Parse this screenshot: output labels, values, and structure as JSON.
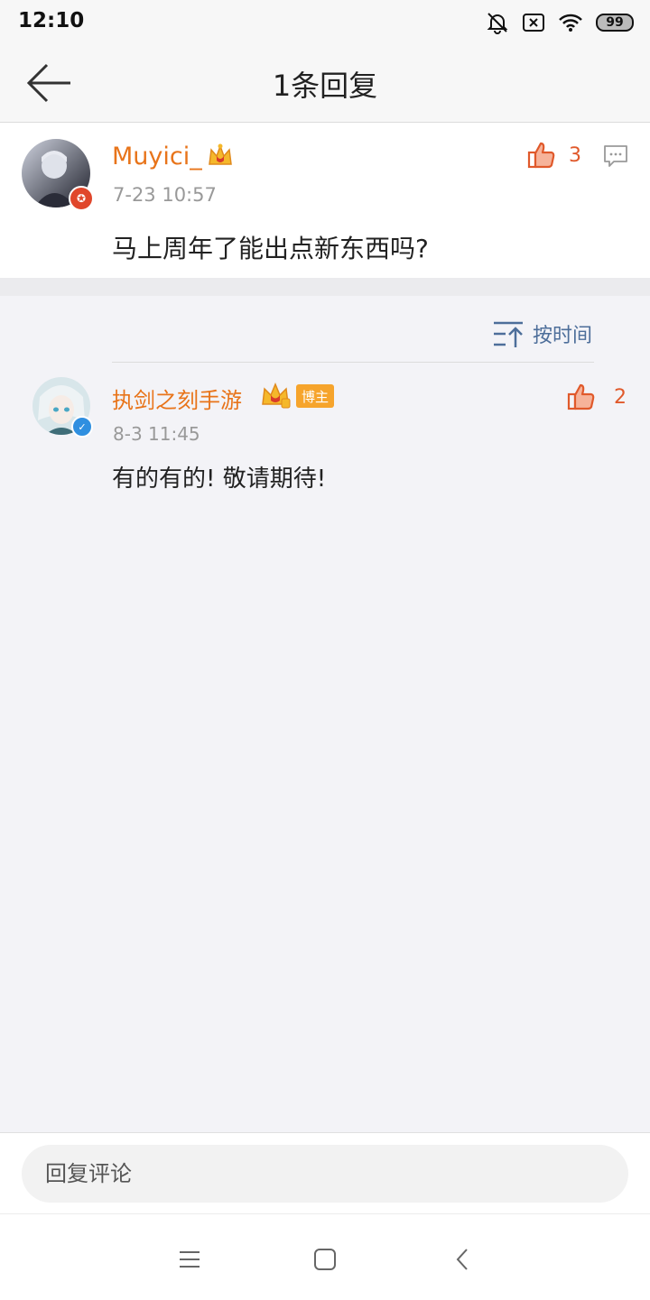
{
  "status_bar": {
    "time": "12:10",
    "icons": [
      "bell-muted-icon",
      "sim-off-icon",
      "wifi-icon",
      "battery-icon"
    ],
    "battery": "99"
  },
  "header": {
    "title": "1条回复",
    "back_icon": "arrow-left-icon"
  },
  "main_comment": {
    "username": "Muyici_",
    "timestamp": "7-23 10:57",
    "content": "马上周年了能出点新东西吗?",
    "likes": "3",
    "like_icon": "thumbs-up-icon",
    "reply_icon": "comment-icon",
    "crown_icon": "crown-icon"
  },
  "sort": {
    "label": "按时间",
    "icon": "sort-icon"
  },
  "reply": {
    "username": "执剑之刻手游",
    "badge": "博主",
    "timestamp": "8-3 11:45",
    "content": "有的有的! 敬请期待!",
    "likes": "2",
    "verified_icon": "verified-check-icon"
  },
  "composer": {
    "placeholder": "回复评论"
  },
  "system_nav": [
    "menu-icon",
    "home-icon",
    "back-icon"
  ],
  "colors": {
    "accent_orange": "#e8741a",
    "like_red": "#e0592b",
    "link_blue": "#4d6e9a",
    "badge_orange": "#f6a42c"
  }
}
